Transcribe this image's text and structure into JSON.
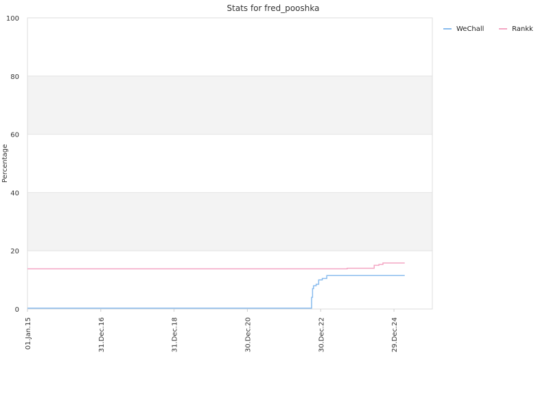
{
  "chart_data": {
    "type": "line",
    "title": "Stats for fred_pooshka",
    "xlabel": "",
    "ylabel": "Percentage",
    "ylim": [
      0,
      100
    ],
    "yticks": [
      "0",
      "20",
      "40",
      "60",
      "80",
      "100"
    ],
    "xlim": [
      "2015-01-01",
      "2026-01-15"
    ],
    "xticks": [
      {
        "date": "2015-01-01",
        "label": "01.Jan.15"
      },
      {
        "date": "2016-12-31",
        "label": "31.Dec.16"
      },
      {
        "date": "2018-12-31",
        "label": "31.Dec.18"
      },
      {
        "date": "2020-12-30",
        "label": "30.Dec.20"
      },
      {
        "date": "2022-12-30",
        "label": "30.Dec.22"
      },
      {
        "date": "2024-12-29",
        "label": "29.Dec.24"
      }
    ],
    "grid": "horizontal alternating bands",
    "legend_position": "top-right",
    "series": [
      {
        "name": "WeChall",
        "color": "#88bbee",
        "step": true,
        "points": [
          [
            "2015-01-01",
            0.3
          ],
          [
            "2022-09-25",
            0.3
          ],
          [
            "2022-10-01",
            4.0
          ],
          [
            "2022-10-10",
            7.0
          ],
          [
            "2022-10-20",
            8.0
          ],
          [
            "2022-11-15",
            8.5
          ],
          [
            "2022-12-10",
            10.0
          ],
          [
            "2023-01-15",
            10.5
          ],
          [
            "2023-03-01",
            11.5
          ],
          [
            "2025-04-15",
            11.5
          ]
        ]
      },
      {
        "name": "Rankk",
        "color": "#f4a6c4",
        "step": true,
        "points": [
          [
            "2015-01-01",
            13.8
          ],
          [
            "2023-09-01",
            13.8
          ],
          [
            "2023-09-20",
            14.0
          ],
          [
            "2024-06-01",
            14.0
          ],
          [
            "2024-06-15",
            15.0
          ],
          [
            "2024-08-01",
            15.3
          ],
          [
            "2024-09-10",
            15.8
          ],
          [
            "2025-04-15",
            15.8
          ]
        ]
      }
    ]
  }
}
